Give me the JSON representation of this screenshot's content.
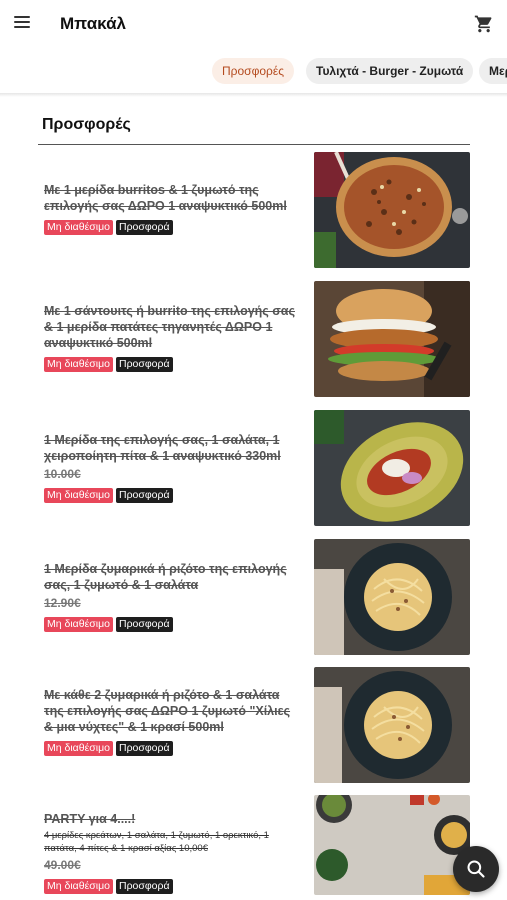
{
  "header": {
    "title": "Μπακάλ"
  },
  "tabs": [
    {
      "label": "Προσφορές",
      "active": true
    },
    {
      "label": "Τυλιχτά - Burger - Ζυμωτά",
      "active": false
    },
    {
      "label": "Μερ",
      "active": false
    }
  ],
  "section": {
    "title": "Προσφορές"
  },
  "badges": {
    "unavailable": "Μη διαθέσιμο",
    "offer": "Προσφορά"
  },
  "items": [
    {
      "name": "Με 1 μερίδα burritos & 1 ζυμωτό της επιλογής σας ΔΩΡΟ 1 αναψυκτικό 500ml",
      "description": "",
      "price": "",
      "image": "pizza-image"
    },
    {
      "name": "Με 1 σάντουιτς ή burrito της επιλογής σας & 1 μερίδα πατάτες τηγανητές ΔΩΡΟ 1 αναψυκτικό 500ml",
      "description": "",
      "price": "",
      "image": "burger-image"
    },
    {
      "name": "1 Μερίδα της επιλογής σας, 1 σαλάτα, 1 χειροποίητη πίτα & 1 αναψυκτικό 330ml",
      "description": "",
      "price": "10.00€",
      "image": "salad-plate-image"
    },
    {
      "name": "1 Μερίδα ζυμαρικά ή ριζότο της επιλογής σας, 1 ζυμωτό & 1 σαλάτα",
      "description": "",
      "price": "12.90€",
      "image": "pasta-image"
    },
    {
      "name": "Με κάθε 2 ζυμαρικά ή ριζότο & 1 σαλάτα της επιλογής σας ΔΩΡΟ 1 ζυμωτό \"Χίλιες & μια νύχτες\" & 1 κρασί 500ml",
      "description": "",
      "price": "",
      "image": "pasta-image-2"
    },
    {
      "name": "PARTY για 4....!",
      "description": "4 μερίδες κρεάτων, 1 σαλάτα, 1 ζυμωτό, 1 ορεκτικό, 1 πατάτα, 4 πίτες & 1 κρασί αξίας 10,00€",
      "price": "49.00€",
      "image": "party-spread-image"
    }
  ],
  "icons": {
    "menu": "hamburger-menu-icon",
    "cart": "shopping-cart-icon",
    "search": "search-icon"
  },
  "colors": {
    "unavailable_badge": "#e8475a",
    "offer_badge": "#1e1e1e",
    "active_tab_bg": "#fbeee6",
    "active_tab_text": "#b44a1e"
  }
}
